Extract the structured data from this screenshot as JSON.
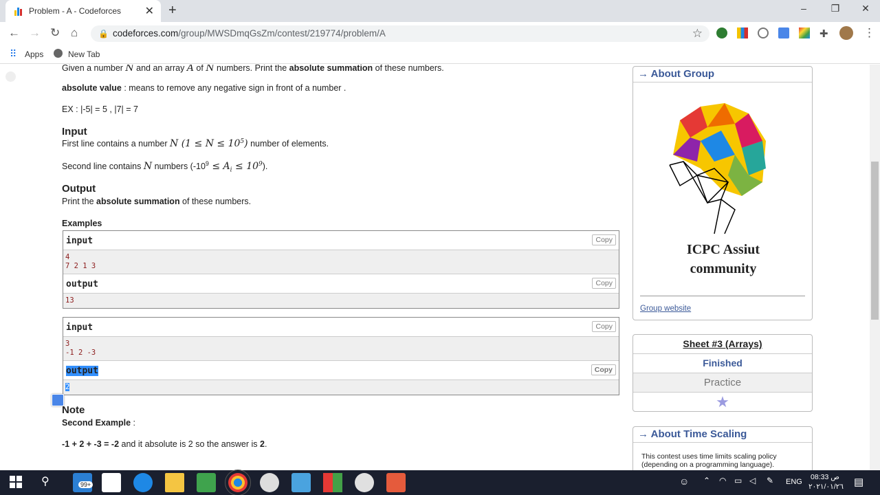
{
  "browser": {
    "tab_title": "Problem - A - Codeforces",
    "close_tab": "✕",
    "new_tab": "+",
    "window_controls": [
      "–",
      "❐",
      "✕"
    ],
    "url_host": "codeforces.com",
    "url_path": "/group/MWSDmqGsZm/contest/219774/problem/A",
    "bookmarks": [
      "Apps",
      "New Tab"
    ]
  },
  "problem": {
    "intro_a": "Given a number ",
    "intro_b": " and an array ",
    "intro_c": " of ",
    "intro_d": " numbers. Print the ",
    "intro_bold": "absolute summation",
    "intro_e": " of these numbers.",
    "var_N": "N",
    "var_A": "A",
    "abs_term": "absolute value",
    "abs_def": " : means to remove any negative sign in front of a number .",
    "ex_line": "EX : |-5| = 5 , |7| = 7",
    "input_title": "Input",
    "input_line1_a": "First line contains a number ",
    "input_line1_math": "N (1 ≤ N ≤ 10",
    "input_line1_sup": "5",
    "input_line1_close": ")",
    "input_line1_b": " number of elements.",
    "input_line2_a": "Second line contains ",
    "input_line2_b": " numbers (-10",
    "input_line2_sup1": "9",
    "input_line2_mid": " ≤ A",
    "input_line2_sub": "i",
    "input_line2_mid2": " ≤ 10",
    "input_line2_sup2": "9",
    "input_line2_end": ").",
    "output_title": "Output",
    "output_a": "Print the ",
    "output_bold": "absolute summation",
    "output_b": " of these numbers.",
    "examples_title": "Examples",
    "examples": [
      {
        "in_label": "input",
        "in_lines": [
          "4",
          "7 2 1 3"
        ],
        "out_label": "output",
        "out_lines": [
          "13"
        ],
        "copy": "Copy"
      },
      {
        "in_label": "input",
        "in_lines": [
          "3",
          "-1 2 -3"
        ],
        "out_label": "output",
        "out_lines": [
          "2"
        ],
        "copy": "Copy"
      }
    ],
    "note_title": "Note",
    "note_sub": "Second Example",
    "note_colon": " :",
    "note_eq": "-1 + 2 + -3 = -2",
    "note_mid": " and it absolute is 2 so the answer is ",
    "note_ans": "2",
    "note_end": "."
  },
  "sidebar": {
    "about_group": "→ About Group",
    "logo_line1": "ICPC Assiut",
    "logo_line2": "community",
    "group_website": "Group website",
    "sheet_title": "Sheet #3 (Arrays)",
    "finished": "Finished",
    "practice": "Practice",
    "about_time": "→ About Time Scaling",
    "time_text1": "This contest uses time limits scaling policy",
    "time_text2": "(depending on a programming language)."
  },
  "taskbar": {
    "mail_badge": "99+",
    "lang": "ENG",
    "time": "08:33 ص",
    "date": "٢٠٢١/٠١/٢٦"
  },
  "colors": {
    "accent": "#3b5998",
    "tab_strip": "#dee1e6",
    "taskbar": "#1a1f2e"
  }
}
